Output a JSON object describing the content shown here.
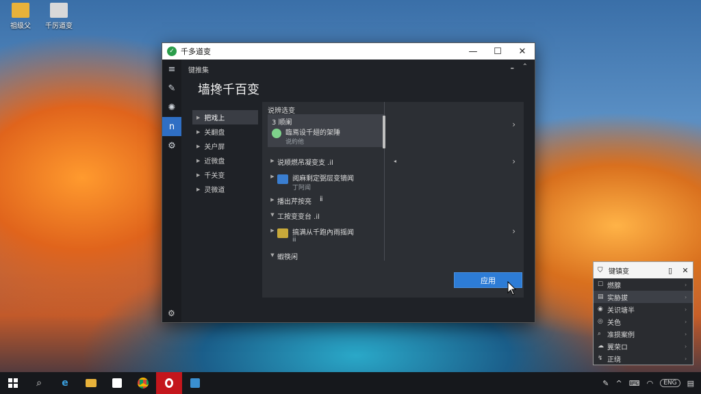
{
  "desktop": {
    "icons": [
      {
        "label": "祖级父",
        "color": "#e8b23a"
      },
      {
        "label": "千厉道变",
        "color": "#d9d9d9"
      }
    ]
  },
  "window": {
    "title": "千多道变",
    "header": "键推集",
    "main_title": "墙搀千百变",
    "categories": [
      {
        "label": "把戏上",
        "selected": true
      },
      {
        "label": "关翻盘",
        "selected": false
      },
      {
        "label": "关户屏",
        "selected": false
      },
      {
        "label": "近微盘",
        "selected": false
      },
      {
        "label": "千关变",
        "selected": false
      },
      {
        "label": "灵微道",
        "selected": false
      }
    ],
    "list": {
      "section_header": "说辨选变",
      "card_item_header": "3 顺阑",
      "card_item_title": "臨焉设千翅的架陲",
      "card_item_sub": "说約他",
      "row1_title": "说顺燃吊凝变支 .il",
      "row2_title": "阅麻剩定弼层变镝闻",
      "row2_sub": "丁阿闻",
      "row3_title": "播出芹按亮",
      "row3_suffix": "ⅱ",
      "row4_title": "工按变变台 .il",
      "row5_title": "搞满从千跑內雨摇闻",
      "row5_sub": "ⅲ",
      "row6_title": "蝦筷闲"
    },
    "apply_label": "应用"
  },
  "mini_window": {
    "title": "键镇变",
    "items": [
      {
        "icon": "☐",
        "label": "燃腺",
        "selected": false
      },
      {
        "icon": "▤",
        "label": "实胁拔",
        "selected": true
      },
      {
        "icon": "◉",
        "label": "关识塘半",
        "selected": false
      },
      {
        "icon": "◎",
        "label": "关色",
        "selected": false
      },
      {
        "icon": "⌕",
        "label": "准损案例",
        "selected": false
      },
      {
        "icon": "☁",
        "label": "翼荣ロ",
        "selected": false
      },
      {
        "icon": "↯",
        "label": "正绕",
        "selected": false
      }
    ]
  },
  "taskbar": {
    "tray_version": "ENG"
  },
  "colors": {
    "accent": "#2d7cd6",
    "window_bg": "#1f2227",
    "title_bar": "#ffffff"
  }
}
